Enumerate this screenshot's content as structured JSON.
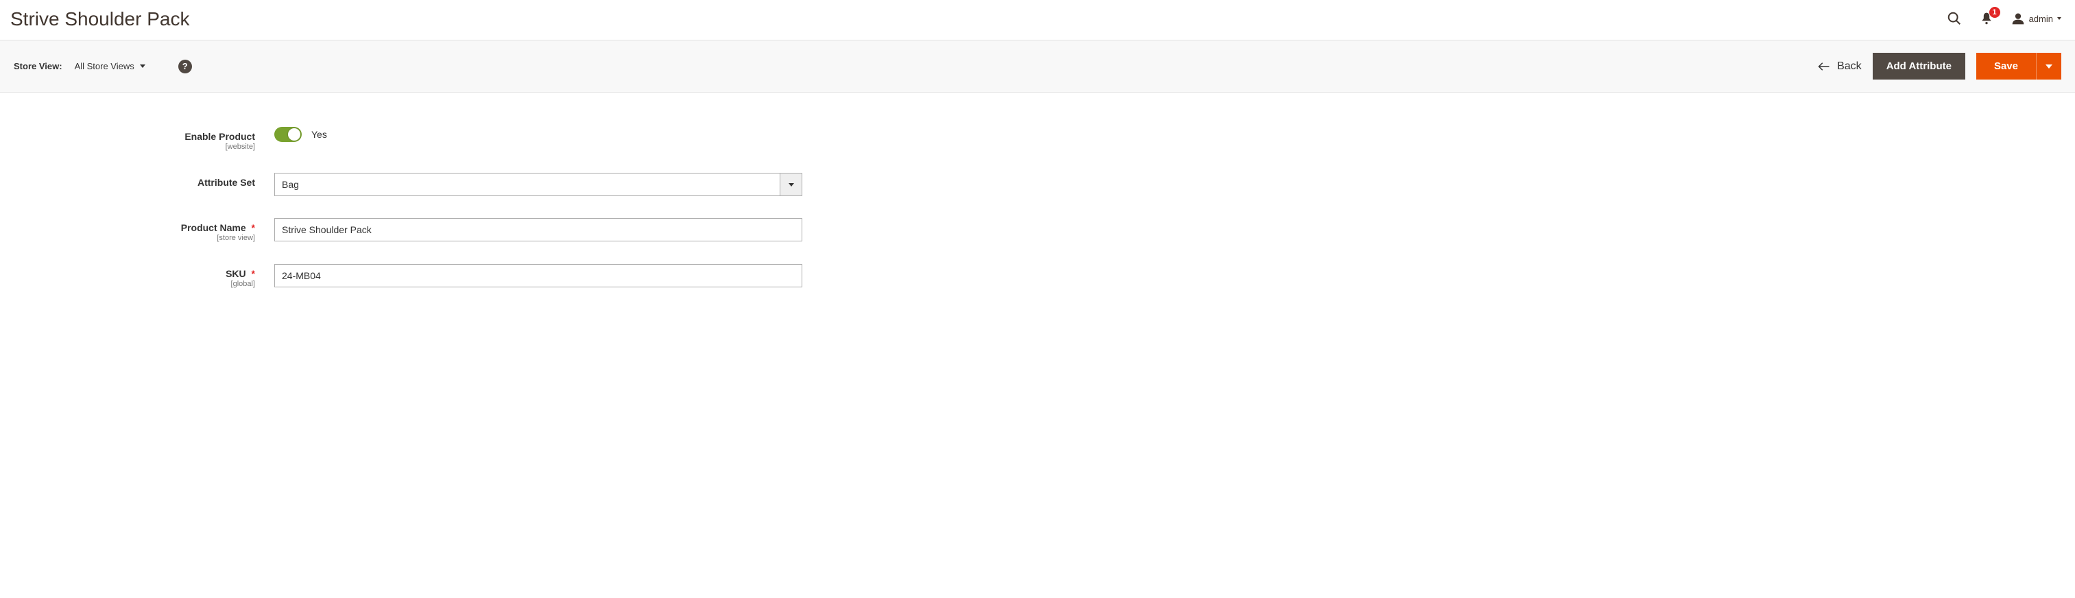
{
  "header": {
    "title": "Strive Shoulder Pack",
    "notifications_count": "1",
    "username": "admin"
  },
  "toolbar": {
    "store_view_label": "Store View:",
    "store_view_value": "All Store Views",
    "back_label": "Back",
    "add_attribute_label": "Add Attribute",
    "save_label": "Save"
  },
  "form": {
    "enable_product": {
      "label": "Enable Product",
      "scope": "[website]",
      "value_label": "Yes"
    },
    "attribute_set": {
      "label": "Attribute Set",
      "value": "Bag"
    },
    "product_name": {
      "label": "Product Name",
      "scope": "[store view]",
      "value": "Strive Shoulder Pack"
    },
    "sku": {
      "label": "SKU",
      "scope": "[global]",
      "value": "24-MB04"
    }
  }
}
